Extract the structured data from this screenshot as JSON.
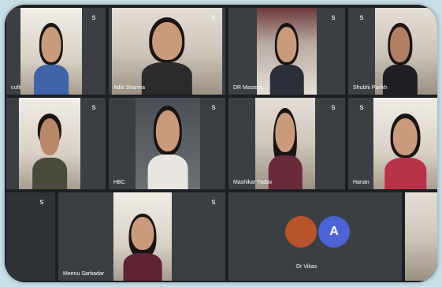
{
  "meeting": {
    "mute_glyph": "s",
    "tiles": [
      {
        "id": "r1c1",
        "label": "cufti"
      },
      {
        "id": "r1c2",
        "label": "Aditi Sharma"
      },
      {
        "id": "r1c3",
        "label": "DR Masters"
      },
      {
        "id": "r1c4",
        "label": "Shubhi Parikh"
      },
      {
        "id": "r2c1",
        "label": ""
      },
      {
        "id": "r2c2",
        "label": "HBC"
      },
      {
        "id": "r2c3",
        "label": "Mashikar Yadav"
      },
      {
        "id": "r2c4",
        "label": "Hanan"
      },
      {
        "id": "r3c1",
        "label": ""
      },
      {
        "id": "r3c2",
        "label": "Meenu Sarbadar"
      },
      {
        "id": "r3c3",
        "label": "Dr Vikas"
      },
      {
        "id": "r3c4",
        "label": ""
      }
    ],
    "avatar_letter": "A"
  },
  "colors": {
    "frame": "#1d2023",
    "tile": "#3b3f43",
    "avatar_blue": "#4b63d6",
    "avatar_photo": "#b7542c"
  }
}
